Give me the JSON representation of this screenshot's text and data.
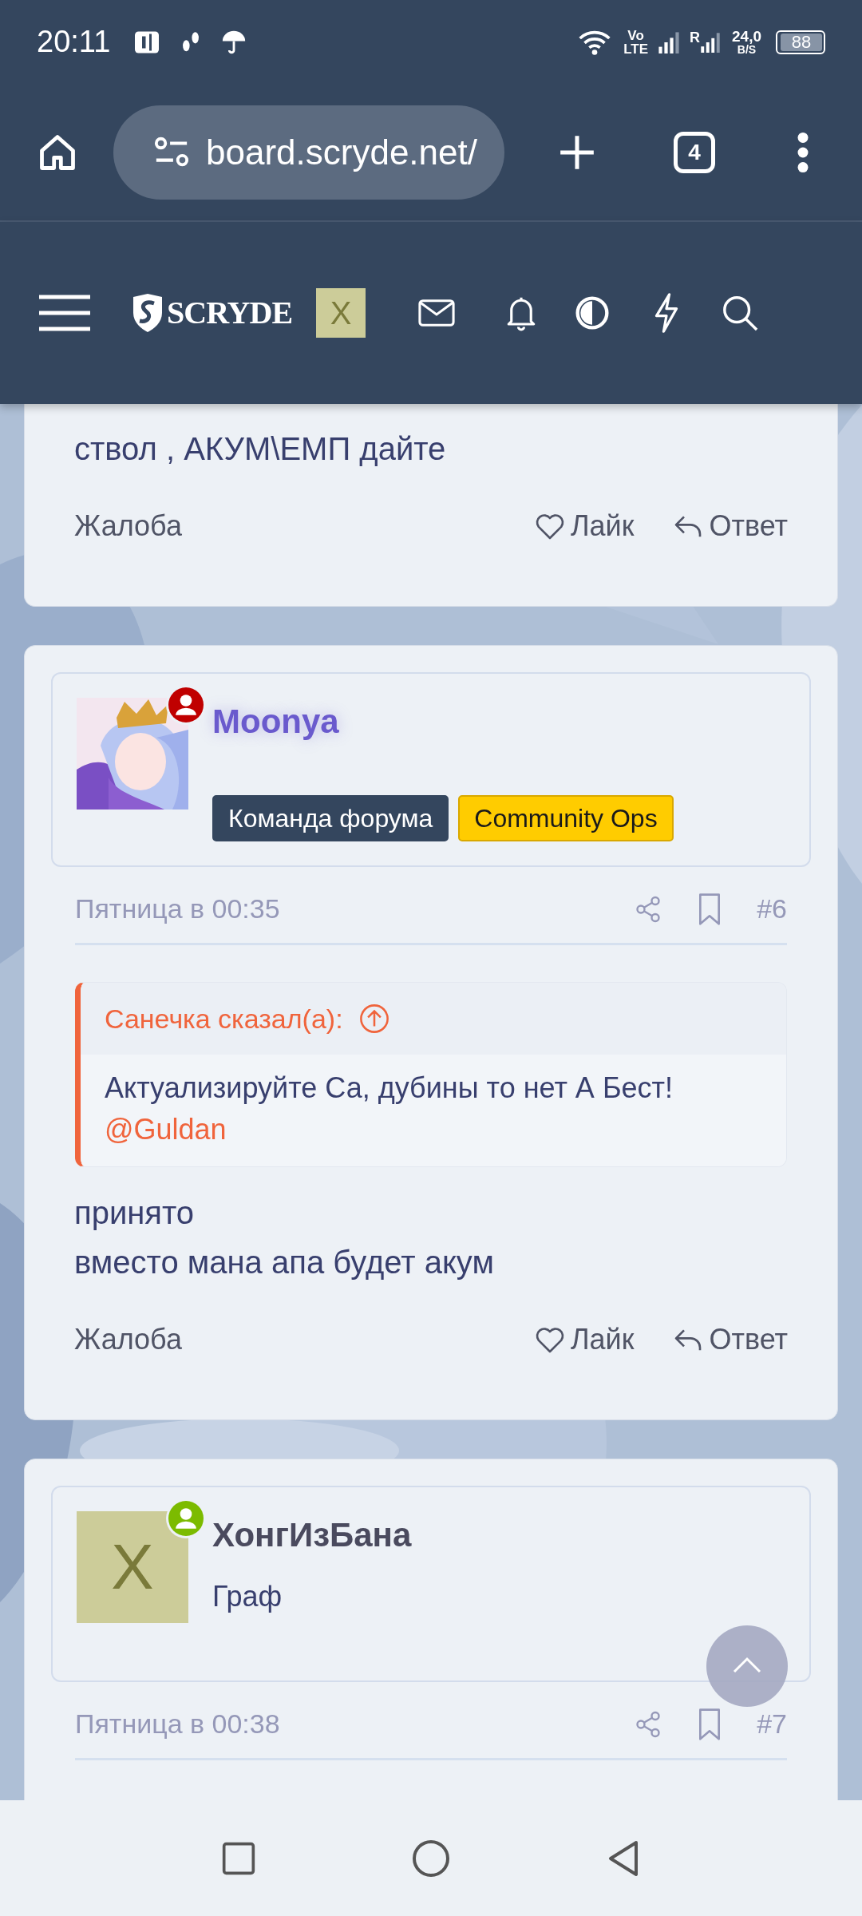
{
  "status_bar": {
    "time": "20:11",
    "volte_top": "Vo",
    "volte_bottom": "LTE",
    "roaming": "R",
    "speed_value": "24,0",
    "speed_unit": "B/S",
    "battery": "88"
  },
  "browser": {
    "url": "board.scryde.net/",
    "tab_count": "4"
  },
  "forum_header": {
    "logo": "SCRYDE",
    "avatar_letter": "X"
  },
  "posts": [
    {
      "kind": "continued",
      "body": [
        "ствол , АКУМ\\ЕМП дайте"
      ],
      "actions": {
        "report": "Жалоба",
        "like": "Лайк",
        "reply": "Ответ"
      }
    },
    {
      "kind": "full",
      "author": {
        "name": "Moonya",
        "kind": "staff",
        "status": {
          "color": "#c00000"
        },
        "banners": [
          {
            "text": "Команда форума",
            "kind": "dark"
          },
          {
            "text": "Community Ops",
            "kind": "yellow"
          }
        ]
      },
      "date": "Пятница в 00:35",
      "number": "#6",
      "quote": {
        "author": "Санечка сказал(а):",
        "text": "Актуализируйте Са, дубины то нет А Бест!",
        "mention": "@Guldan"
      },
      "body": [
        "принято",
        "вместо мана апа будет акум"
      ],
      "actions": {
        "report": "Жалоба",
        "like": "Лайк",
        "reply": "Ответ"
      }
    },
    {
      "kind": "full",
      "author": {
        "name": "ХонгИзБана",
        "kind": "member",
        "avatar": {
          "kind": "letter",
          "letter": "X"
        },
        "status": {
          "color": "#7cbb00"
        },
        "title": "Граф"
      },
      "date": "Пятница в 00:38",
      "number": "#7"
    }
  ]
}
